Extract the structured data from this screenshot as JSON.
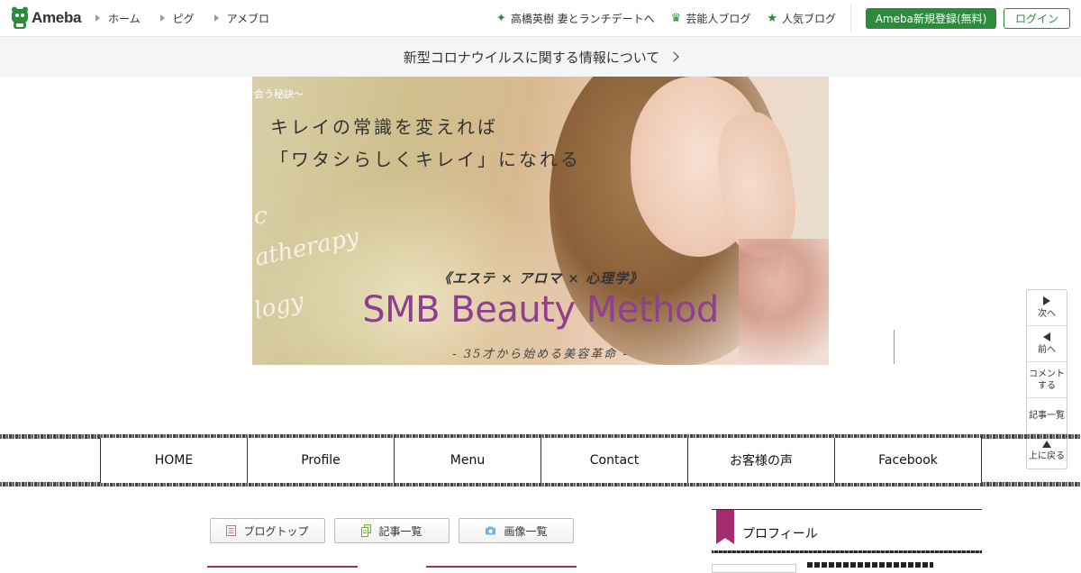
{
  "header": {
    "logo_text": "Ameba",
    "nav_left": [
      "ホーム",
      "ピグ",
      "アメブロ"
    ],
    "nav_right": [
      {
        "label": "高橋英樹 妻とランチデートへ",
        "icon": "sparkle-icon"
      },
      {
        "label": "芸能人ブログ",
        "icon": "crown-icon"
      },
      {
        "label": "人気ブログ",
        "icon": "star-icon"
      }
    ],
    "register_label": "Ameba新規登録(無料)",
    "login_label": "ログイン",
    "accent_color": "#2d8c3c"
  },
  "notice": {
    "text": "新型コロナウイルスに関する情報について"
  },
  "hero": {
    "small_text": "会う秘訣～",
    "line1": "キレイの常識を変えれば",
    "line2": "「ワタシらしくキレイ」になれる",
    "subtitle": "《エステ × アロマ × 心理学》",
    "title": "SMB Beauty Method",
    "tagline": "- 35才から始める美容革命 -",
    "script1": "c",
    "script2": "atherapy",
    "script3": "logy"
  },
  "side_nav": {
    "next": "次へ",
    "prev": "前へ",
    "comment_line1": "コメント",
    "comment_line2": "する",
    "list": "記事一覧",
    "top": "上に戻る"
  },
  "menu": {
    "items": [
      "HOME",
      "Profile",
      "Menu",
      "Contact",
      "お客様の声",
      "Facebook"
    ]
  },
  "blog_buttons": {
    "top": "ブログトップ",
    "list": "記事一覧",
    "images": "画像一覧"
  },
  "profile": {
    "title": "プロフィール",
    "accent_color": "#a52a6e"
  }
}
